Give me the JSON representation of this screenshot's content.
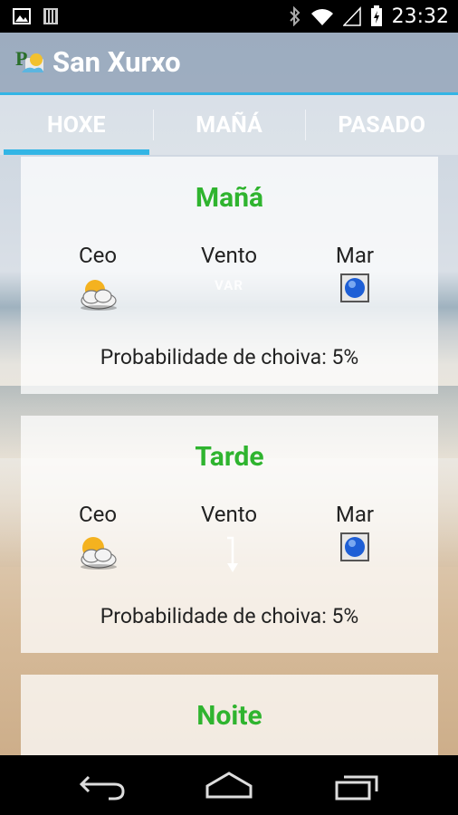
{
  "status_bar": {
    "time": "23:32"
  },
  "app": {
    "title": "San Xurxo"
  },
  "tabs": [
    {
      "label": "HOXE",
      "active": true
    },
    {
      "label": "MAÑÁ",
      "active": false
    },
    {
      "label": "PASADO",
      "active": false
    }
  ],
  "cards": [
    {
      "period": "Mañá",
      "columns": {
        "sky": "Ceo",
        "wind": "Vento",
        "sea": "Mar"
      },
      "wind_value": "VAR",
      "rain_text": "Probabilidade de choiva: 5%"
    },
    {
      "period": "Tarde",
      "columns": {
        "sky": "Ceo",
        "wind": "Vento",
        "sea": "Mar"
      },
      "rain_text": "Probabilidade de choiva: 5%"
    },
    {
      "period": "Noite"
    }
  ],
  "colors": {
    "accent": "#33b5e5",
    "period_text": "#2fb42f"
  },
  "icons": [
    "image-icon",
    "sim-icon",
    "bluetooth-icon",
    "wifi-icon",
    "signal-icon",
    "battery-icon",
    "back-icon",
    "home-icon",
    "recents-icon"
  ]
}
